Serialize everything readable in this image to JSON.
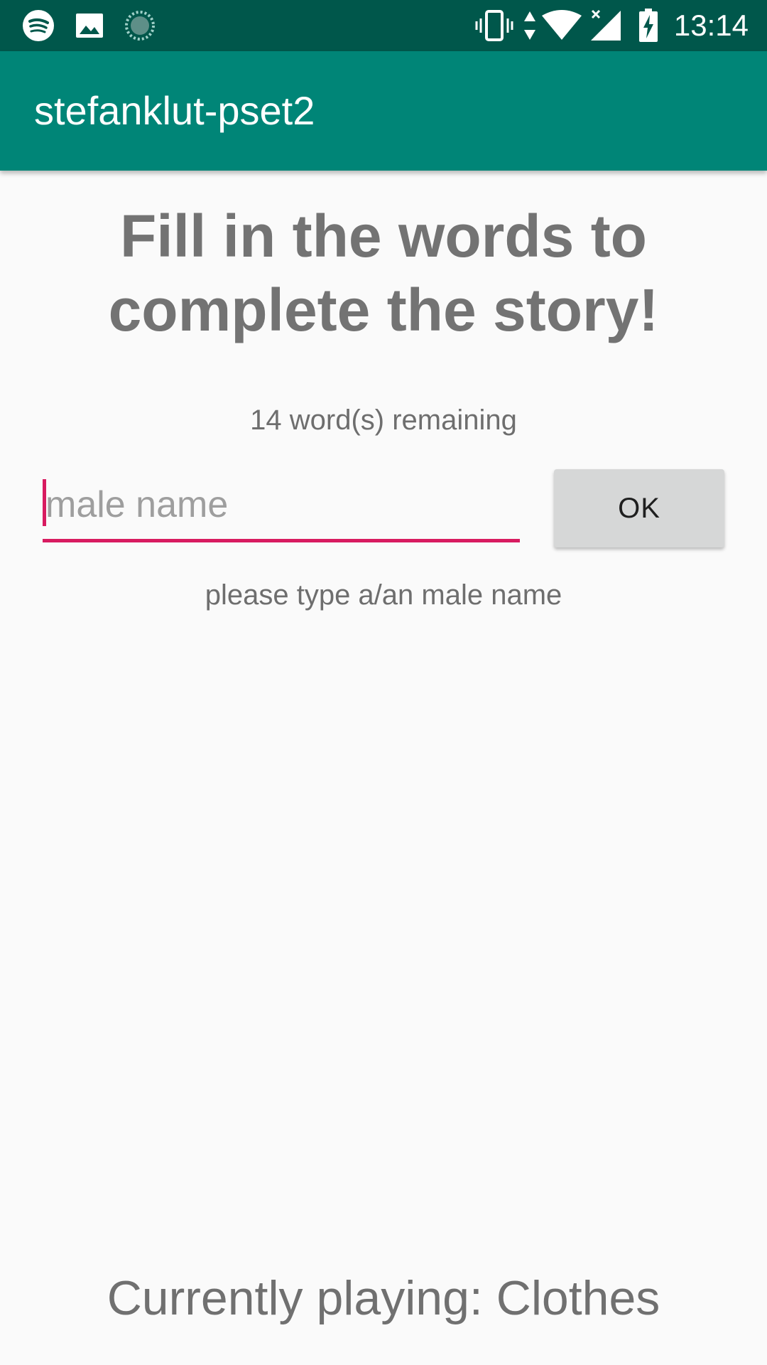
{
  "status_bar": {
    "time": "13:14",
    "left_icons": [
      "spotify-icon",
      "image-icon",
      "loading-icon"
    ],
    "right_icons": [
      "vibrate-icon",
      "data-arrows-icon",
      "wifi-icon",
      "cell-signal-icon",
      "battery-charging-icon"
    ]
  },
  "app_bar": {
    "title": "stefanklut-pset2"
  },
  "main": {
    "heading": "Fill in the words to complete the story!",
    "remaining": "14 word(s) remaining",
    "input": {
      "value": "",
      "placeholder": "male name"
    },
    "ok_label": "OK",
    "hint": "please type a/an male name",
    "now_playing": "Currently playing: Clothes"
  },
  "colors": {
    "status_bar": "#00574b",
    "app_bar": "#008577",
    "accent": "#d81b60",
    "button": "#d6d7d7",
    "background": "#fafafa"
  }
}
